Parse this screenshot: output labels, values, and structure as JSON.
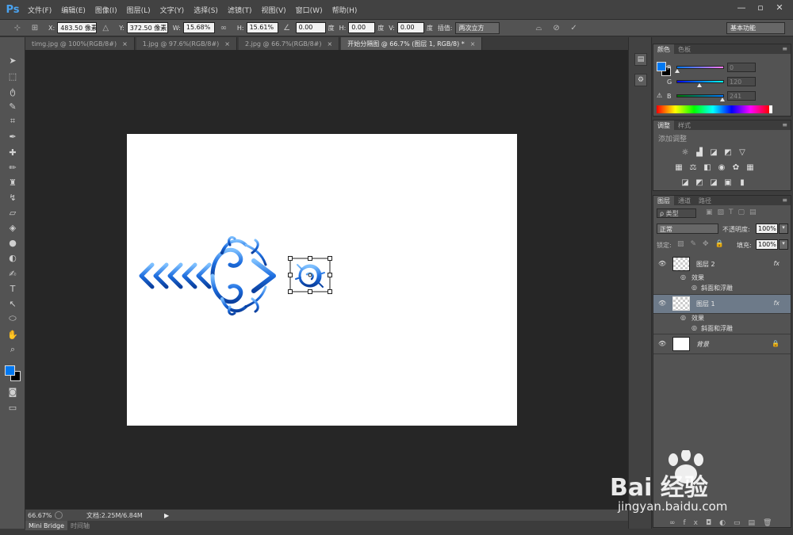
{
  "app": {
    "logo": "Ps",
    "menu": [
      "文件(F)",
      "编辑(E)",
      "图像(I)",
      "图层(L)",
      "文字(Y)",
      "选择(S)",
      "滤镜(T)",
      "视图(V)",
      "窗口(W)",
      "帮助(H)"
    ],
    "window_controls": [
      "—",
      "▫",
      "✕"
    ]
  },
  "options": {
    "x_label": "X:",
    "x_value": "483.50 像素",
    "y_label": "Y:",
    "y_value": "372.50 像素",
    "w_label": "W:",
    "w_value": "15.68%",
    "h_label": "H:",
    "h_value": "15.61%",
    "angle_value": "0.00",
    "angle_unit": "度",
    "hskew_label": "H:",
    "hskew_value": "0.00",
    "hskew_unit": "度",
    "vskew_label": "V:",
    "vskew_value": "0.00",
    "vskew_unit": "度",
    "interp_label": "插值:",
    "interp_value": "两次立方",
    "workspace": "基本功能"
  },
  "tabs": [
    {
      "label": "timg.jpg @ 100%(RGB/8#)",
      "close": "×"
    },
    {
      "label": "1.jpg @ 97.6%(RGB/8#)",
      "close": "×"
    },
    {
      "label": "2.jpg @ 66.7%(RGB/8#)",
      "close": "×"
    },
    {
      "label": "开始分隔图 @ 66.7% (图层 1, RGB/8) *",
      "close": "×"
    }
  ],
  "status": {
    "zoom": "66.67%",
    "doc_info": "文档:2.25M/6.84M",
    "bottom_tabs": [
      "Mini Bridge",
      "时间轴"
    ]
  },
  "color_panel": {
    "tabs": [
      "颜色",
      "色板"
    ],
    "r_label": "R",
    "r_value": "0",
    "g_label": "G",
    "g_value": "120",
    "b_label": "B",
    "b_value": "241",
    "foreground": "#0078f1"
  },
  "adjust_panel": {
    "tabs": [
      "调整",
      "样式"
    ],
    "title": "添加调整"
  },
  "layers_panel": {
    "tabs": [
      "图层",
      "通道",
      "路径"
    ],
    "filter": "ρ 类型",
    "blend_mode": "正常",
    "opacity_label": "不透明度:",
    "opacity_value": "100%",
    "lock_label": "锁定:",
    "fill_label": "填充:",
    "fill_value": "100%",
    "layers": [
      {
        "name": "图层 2",
        "fx": "fx",
        "effect": "效果",
        "sub_effect": "斜面和浮雕"
      },
      {
        "name": "图层 1",
        "fx": "fx",
        "effect": "效果",
        "sub_effect": "斜面和浮雕"
      },
      {
        "name": "背景"
      }
    ]
  },
  "watermark": {
    "brand": "Bai 经验",
    "url": "jingyan.baidu.com"
  }
}
